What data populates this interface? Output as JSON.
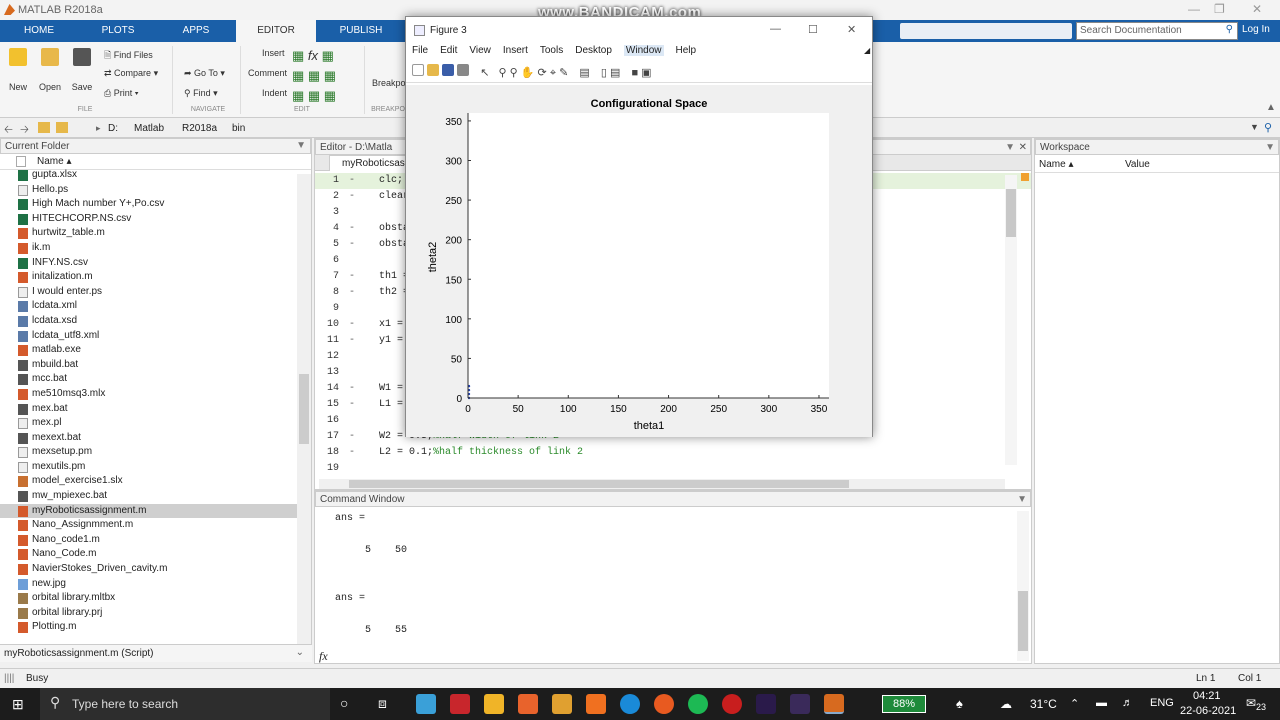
{
  "window": {
    "title": "MATLAB R2018a",
    "watermark": "www.BANDICAM.com"
  },
  "tabs": [
    "HOME",
    "PLOTS",
    "APPS",
    "EDITOR",
    "PUBLISH"
  ],
  "search": {
    "placeholder": "Search Documentation"
  },
  "login": "Log In",
  "ribbon": {
    "new": "New",
    "open": "Open",
    "save": "Save",
    "find_files": "Find Files",
    "compare": "Compare",
    "print": "Print",
    "go_to": "Go To",
    "find": "Find",
    "insert": "Insert",
    "comment": "Comment",
    "indent": "Indent",
    "breakpoints": "Breakpo",
    "sections": {
      "file": "FILE",
      "navigate": "NAVIGATE",
      "edit": "EDIT",
      "breakpoints": "BREAKPO"
    }
  },
  "address": {
    "parts": [
      "D:",
      "Matlab",
      "R2018a",
      "bin"
    ]
  },
  "current_folder": {
    "title": "Current Folder",
    "column": "Name",
    "files": [
      {
        "name": "gupta.xlsx",
        "type": "fxl"
      },
      {
        "name": "Hello.ps",
        "type": "ftxt"
      },
      {
        "name": "High Mach number Y+,Po.csv",
        "type": "fxl"
      },
      {
        "name": "HITECHCORP.NS.csv",
        "type": "fxl"
      },
      {
        "name": "hurtwitz_table.m",
        "type": "fm"
      },
      {
        "name": "ik.m",
        "type": "fm"
      },
      {
        "name": "INFY.NS.csv",
        "type": "fxl"
      },
      {
        "name": "initalization.m",
        "type": "fm"
      },
      {
        "name": "I would enter.ps",
        "type": "ftxt"
      },
      {
        "name": "lcdata.xml",
        "type": "fxml"
      },
      {
        "name": "lcdata.xsd",
        "type": "fxml"
      },
      {
        "name": "lcdata_utf8.xml",
        "type": "fxml"
      },
      {
        "name": "matlab.exe",
        "type": "fm"
      },
      {
        "name": "mbuild.bat",
        "type": "fbat"
      },
      {
        "name": "mcc.bat",
        "type": "fbat"
      },
      {
        "name": "me510msq3.mlx",
        "type": "fm"
      },
      {
        "name": "mex.bat",
        "type": "fbat"
      },
      {
        "name": "mex.pl",
        "type": "ftxt"
      },
      {
        "name": "mexext.bat",
        "type": "fbat"
      },
      {
        "name": "mexsetup.pm",
        "type": "ftxt"
      },
      {
        "name": "mexutils.pm",
        "type": "ftxt"
      },
      {
        "name": "model_exercise1.slx",
        "type": "fslx"
      },
      {
        "name": "mw_mpiexec.bat",
        "type": "fbat"
      },
      {
        "name": "myRoboticsassignment.m",
        "type": "fm"
      },
      {
        "name": "Nano_Assignmment.m",
        "type": "fm"
      },
      {
        "name": "Nano_code1.m",
        "type": "fm"
      },
      {
        "name": "Nano_Code.m",
        "type": "fm"
      },
      {
        "name": "NavierStokes_Driven_cavity.m",
        "type": "fm"
      },
      {
        "name": "new.jpg",
        "type": "fjpg"
      },
      {
        "name": "orbital library.mltbx",
        "type": "fprj"
      },
      {
        "name": "orbital library.prj",
        "type": "fprj"
      },
      {
        "name": "Plotting.m",
        "type": "fm"
      }
    ],
    "status": "myRoboticsassignment.m  (Script)"
  },
  "editor": {
    "title": "Editor - D:\\Matla",
    "tab": "myRoboticsass",
    "lines": [
      {
        "n": "1",
        "code": "clc;",
        "comment": ""
      },
      {
        "n": "2",
        "code": "clear",
        "comment": ""
      },
      {
        "n": "3",
        "code": "",
        "comment": ""
      },
      {
        "n": "4",
        "code": "obsta",
        "comment": ""
      },
      {
        "n": "5",
        "code": "obsta",
        "comment": ""
      },
      {
        "n": "6",
        "code": "",
        "comment": ""
      },
      {
        "n": "7",
        "code": "th1 =",
        "comment": ""
      },
      {
        "n": "8",
        "code": "th2 =",
        "comment": ""
      },
      {
        "n": "9",
        "code": "",
        "comment": ""
      },
      {
        "n": "10",
        "code": "x1 =",
        "comment": ""
      },
      {
        "n": "11",
        "code": "y1 =",
        "comment": ""
      },
      {
        "n": "12",
        "code": "",
        "comment": ""
      },
      {
        "n": "13",
        "code": "",
        "comment": ""
      },
      {
        "n": "14",
        "code": "W1 =",
        "comment": ""
      },
      {
        "n": "15",
        "code": "L1 =",
        "comment": ""
      },
      {
        "n": "16",
        "code": "",
        "comment": ""
      },
      {
        "n": "17",
        "code": "W2 = 0.5;",
        "comment": "%half width of link 2"
      },
      {
        "n": "18",
        "code": "L2 = 0.1;",
        "comment": "%half thickness of link 2"
      },
      {
        "n": "19",
        "code": "",
        "comment": ""
      }
    ]
  },
  "command_window": {
    "title": "Command Window",
    "blocks": [
      {
        "label": "ans =",
        "value": "     5    50"
      },
      {
        "label": "ans =",
        "value": "     5    55"
      }
    ],
    "prompt": "fx"
  },
  "workspace": {
    "title": "Workspace",
    "col_name": "Name",
    "col_value": "Value"
  },
  "status": {
    "busy": "Busy",
    "ln": "Ln  1",
    "col": "Col  1"
  },
  "figure": {
    "title": "Figure 3",
    "menu": [
      "File",
      "Edit",
      "View",
      "Insert",
      "Tools",
      "Desktop",
      "Window",
      "Help"
    ]
  },
  "chart_data": {
    "type": "scatter",
    "title": "Configurational Space",
    "xlabel": "theta1",
    "ylabel": "theta2",
    "xlim": [
      0,
      360
    ],
    "ylim": [
      0,
      360
    ],
    "xticks": [
      0,
      50,
      100,
      150,
      200,
      250,
      300,
      350
    ],
    "yticks": [
      0,
      50,
      100,
      150,
      200,
      250,
      300,
      350
    ],
    "points": [
      [
        0,
        0
      ],
      [
        0,
        5
      ],
      [
        0,
        10
      ],
      [
        0,
        15
      ]
    ],
    "color": "#1f3fb0"
  },
  "taskbar": {
    "search": "Type here to search",
    "battery": "88%",
    "temp": "31°C",
    "lang": "ENG",
    "time": "04:21",
    "date": "22-06-2021",
    "notif": "23"
  }
}
